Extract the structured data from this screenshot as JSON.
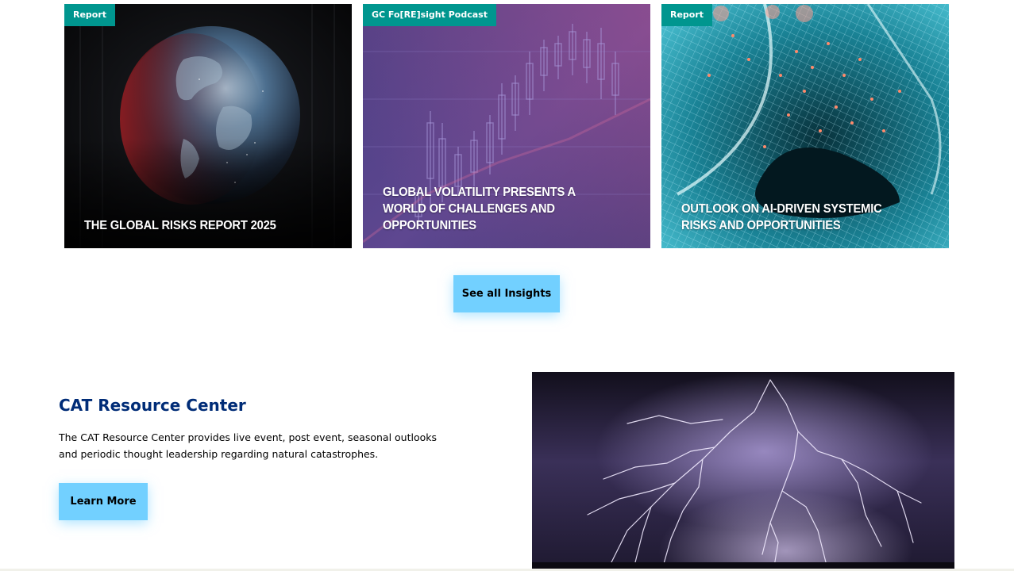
{
  "insights": {
    "cards": [
      {
        "badge": "Report",
        "title": "THE GLOBAL RISKS REPORT 2025"
      },
      {
        "badge": "GC Fo[RE]sight Podcast",
        "title": "GLOBAL VOLATILITY PRESENTS A WORLD OF CHALLENGES AND OPPORTUNITIES"
      },
      {
        "badge": "Report",
        "title": "OUTLOOK ON AI-DRIVEN SYSTEMIC RISKS AND OPPORTUNITIES"
      }
    ],
    "see_all_label": "See all Insights"
  },
  "cat_resource": {
    "title": "CAT Resource Center",
    "description": "The CAT Resource Center provides live event, post event, seasonal outlooks and periodic thought leadership regarding natural catastrophes.",
    "learn_more_label": "Learn More"
  },
  "colors": {
    "badge": "#00968f",
    "button": "#72d0ff",
    "heading": "#002c77"
  }
}
